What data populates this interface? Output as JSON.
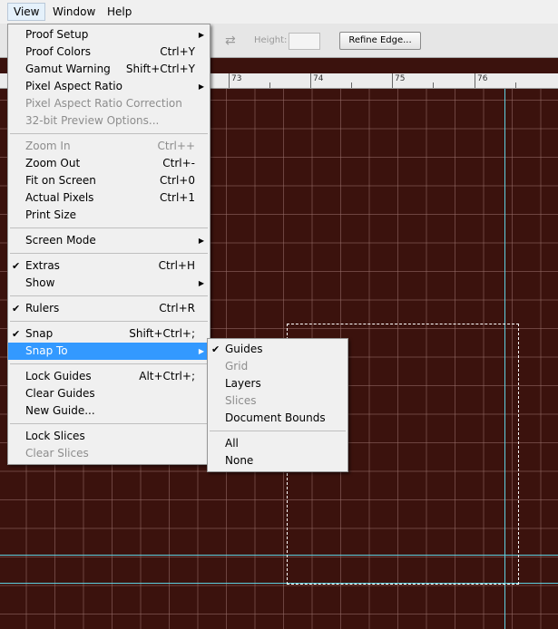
{
  "menubar": {
    "items": [
      {
        "label": "View",
        "active": true
      },
      {
        "label": "Window"
      },
      {
        "label": "Help"
      }
    ]
  },
  "options_bar": {
    "height_label": "Height:",
    "refine_edge_label": "Refine Edge..."
  },
  "ruler": {
    "labels": [
      "73",
      "74",
      "75",
      "76"
    ]
  },
  "view_menu": {
    "items": [
      {
        "label": "Proof Setup",
        "submenu": true
      },
      {
        "label": "Proof Colors",
        "shortcut": "Ctrl+Y"
      },
      {
        "label": "Gamut Warning",
        "shortcut": "Shift+Ctrl+Y"
      },
      {
        "label": "Pixel Aspect Ratio",
        "submenu": true
      },
      {
        "label": "Pixel Aspect Ratio Correction",
        "disabled": true
      },
      {
        "label": "32-bit Preview Options...",
        "disabled": true
      },
      {
        "separator": true
      },
      {
        "label": "Zoom In",
        "shortcut": "Ctrl++",
        "disabled": true
      },
      {
        "label": "Zoom Out",
        "shortcut": "Ctrl+-"
      },
      {
        "label": "Fit on Screen",
        "shortcut": "Ctrl+0"
      },
      {
        "label": "Actual Pixels",
        "shortcut": "Ctrl+1"
      },
      {
        "label": "Print Size"
      },
      {
        "separator": true
      },
      {
        "label": "Screen Mode",
        "submenu": true
      },
      {
        "separator": true
      },
      {
        "label": "Extras",
        "shortcut": "Ctrl+H",
        "checked": true
      },
      {
        "label": "Show",
        "submenu": true
      },
      {
        "separator": true
      },
      {
        "label": "Rulers",
        "shortcut": "Ctrl+R",
        "checked": true
      },
      {
        "separator": true
      },
      {
        "label": "Snap",
        "shortcut": "Shift+Ctrl+;",
        "checked": true
      },
      {
        "label": "Snap To",
        "submenu": true,
        "highlight": true
      },
      {
        "separator": true
      },
      {
        "label": "Lock Guides",
        "shortcut": "Alt+Ctrl+;"
      },
      {
        "label": "Clear Guides"
      },
      {
        "label": "New Guide..."
      },
      {
        "separator": true
      },
      {
        "label": "Lock Slices"
      },
      {
        "label": "Clear Slices",
        "disabled": true
      }
    ]
  },
  "snap_to_menu": {
    "items": [
      {
        "label": "Guides",
        "checked": true
      },
      {
        "label": "Grid",
        "disabled": true
      },
      {
        "label": "Layers"
      },
      {
        "label": "Slices",
        "disabled": true
      },
      {
        "label": "Document Bounds"
      },
      {
        "separator": true
      },
      {
        "label": "All"
      },
      {
        "label": "None"
      }
    ]
  },
  "colors": {
    "canvas": "#3b120d",
    "guide": "#5fd0e0",
    "highlight": "#3399ff"
  }
}
